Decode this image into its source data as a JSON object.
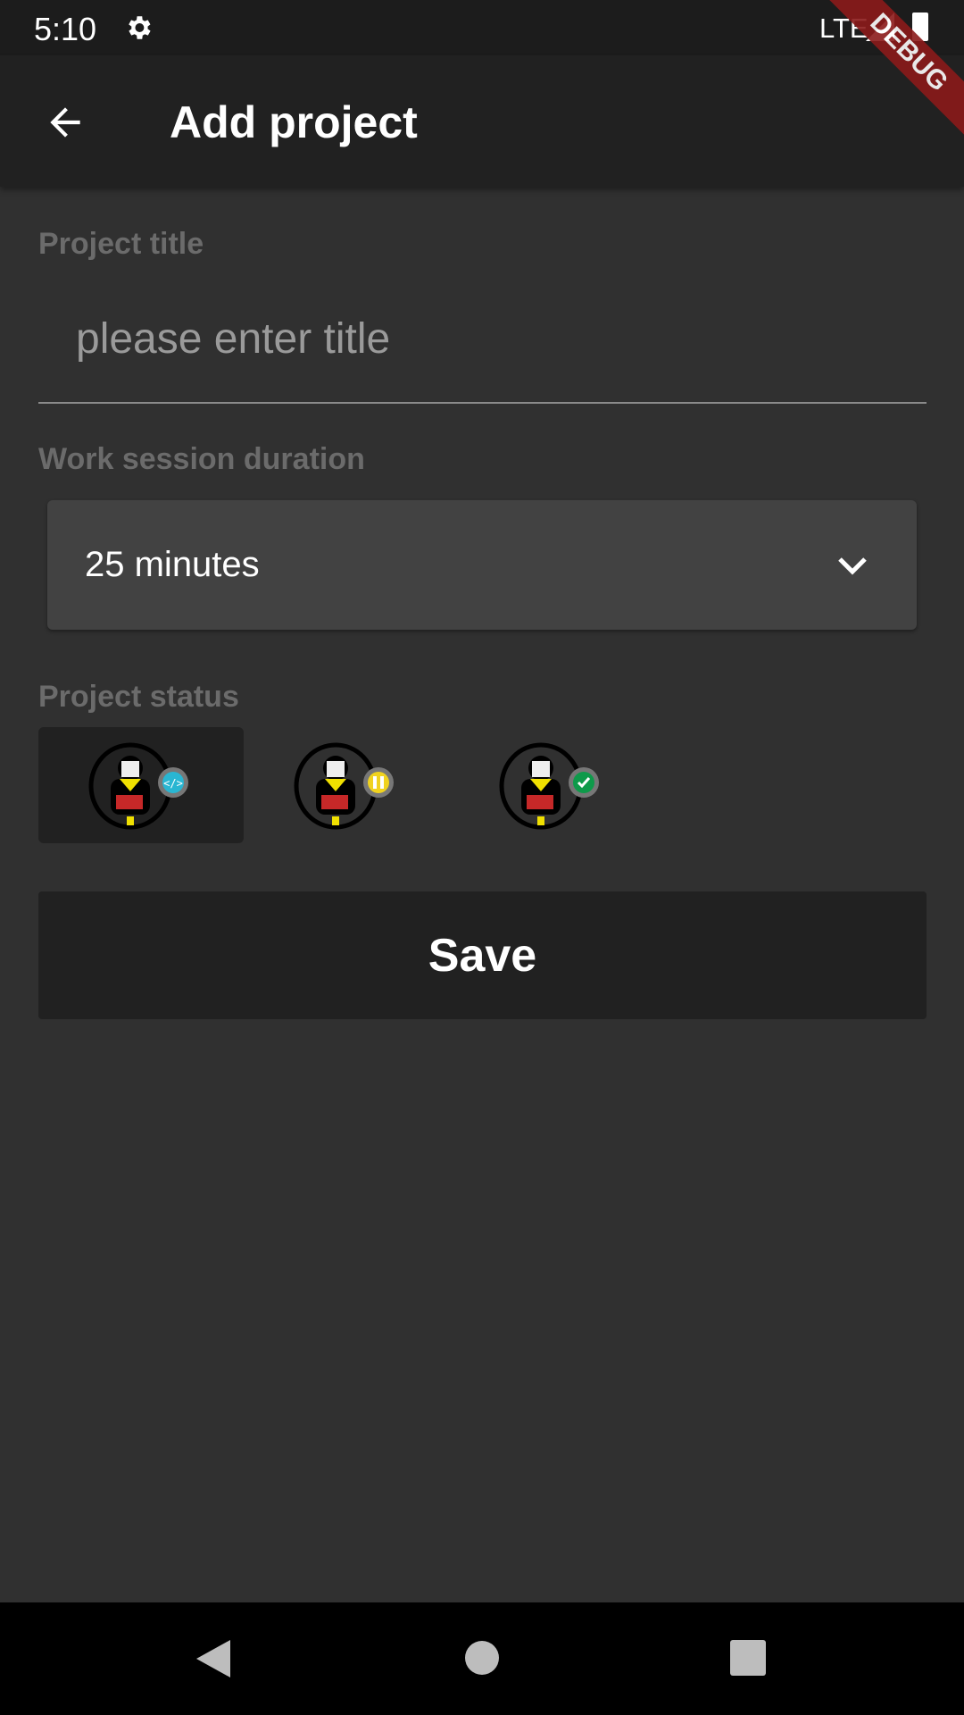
{
  "status_bar": {
    "time": "5:10",
    "network": "LTE"
  },
  "debug_banner": "DEBUG",
  "app_bar": {
    "title": "Add project"
  },
  "form": {
    "title_label": "Project title",
    "title_placeholder": "please enter title",
    "title_value": "",
    "duration_label": "Work session duration",
    "duration_value": "25 minutes",
    "status_label": "Project status",
    "statuses": [
      {
        "name": "in-progress",
        "badge_color": "#29b6d2",
        "selected": true
      },
      {
        "name": "paused",
        "badge_color": "#f0d21e",
        "selected": false
      },
      {
        "name": "done",
        "badge_color": "#0e9a4a",
        "selected": false
      }
    ],
    "save_label": "Save"
  }
}
